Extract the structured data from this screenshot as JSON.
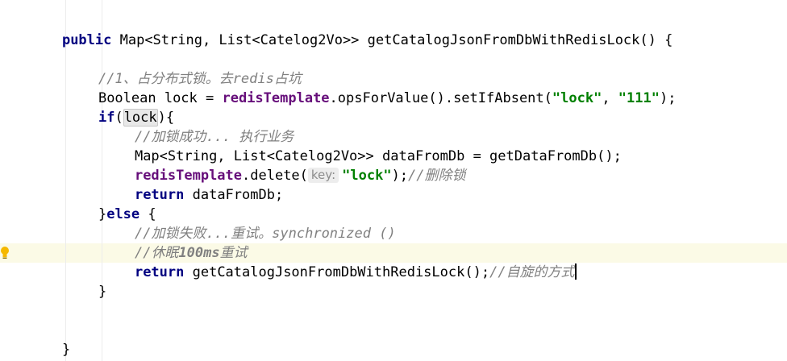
{
  "code": {
    "l1": {
      "modifier": "public",
      "text": " Map<String, List<Catelog2Vo>> getCatalogJsonFromDbWithRedisLock() {"
    },
    "l2": {
      "comment_prefix": "//1、",
      "comment_cjk": "占分布式锁。去",
      "comment_word": "redis",
      "comment_cjk2": "占坑"
    },
    "l3": {
      "part1": "Boolean lock = ",
      "field": "redisTemplate",
      "part2": ".opsForValue().setIfAbsent(",
      "str1": "\"lock\"",
      "comma": ", ",
      "str2": "\"111\"",
      "part3": ");"
    },
    "l4": {
      "keyword": "if",
      "open": "(",
      "var": "lock",
      "close": "){"
    },
    "l5": {
      "comment_prefix": "//",
      "comment_cjk": "加锁成功",
      "comment_dots": "... ",
      "comment_cjk2": "执行业务"
    },
    "l6": {
      "text": "Map<String, List<Catelog2Vo>> dataFromDb = getDataFromDb();"
    },
    "l7": {
      "field": "redisTemplate",
      "part1": ".delete(",
      "hint": "key:",
      "str": "\"lock\"",
      "part2": ");",
      "comment_prefix": "//",
      "comment_cjk": "删除锁"
    },
    "l8": {
      "keyword": "return",
      "text": " dataFromDb;"
    },
    "l9": {
      "brace": "}",
      "keyword": "else",
      "text": " {"
    },
    "l10": {
      "comment_prefix": "//",
      "comment_cjk": "加锁失败",
      "comment_dots": "...",
      "comment_cjk2": "重试。",
      "comment_word": "synchronized ()"
    },
    "l11": {
      "comment_prefix": "//",
      "comment_cjk": "休眠",
      "comment_word": "100ms",
      "comment_cjk2": "重试"
    },
    "l12": {
      "keyword": "return",
      "text": " getCatalogJsonFromDbWithRedisLock();",
      "comment_prefix": "//",
      "comment_cjk": "自旋的方式"
    },
    "l13": {
      "text": "}"
    },
    "l14": {
      "text": "}"
    }
  },
  "icons": {
    "gutter": "lightbulb-icon"
  },
  "colors": {
    "keyword": "#000080",
    "field": "#660e7a",
    "string": "#008000",
    "comment": "#808080",
    "current_line": "#fbfae6",
    "bulb": "#f5b800"
  }
}
